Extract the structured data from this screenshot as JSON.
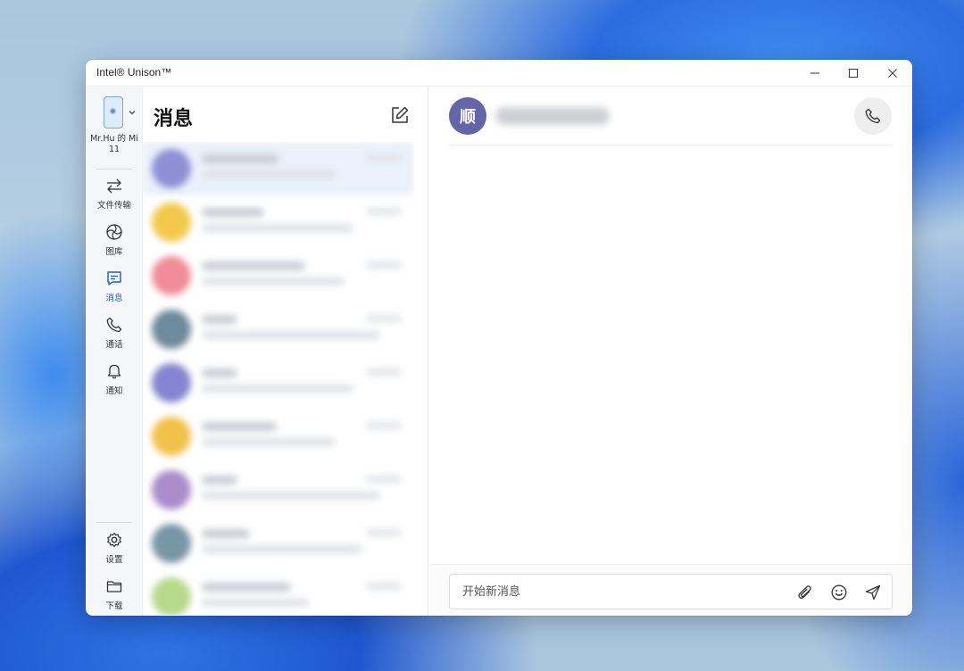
{
  "app": {
    "title": "Intel® Unison™"
  },
  "window_controls": {
    "minimize": "minimize-icon",
    "maximize": "maximize-icon",
    "close": "close-icon"
  },
  "device": {
    "name": "Mr.Hu 的 Mi 11",
    "icon": "phone-icon"
  },
  "nav": {
    "items": [
      {
        "id": "file-transfer",
        "label": "文件传输",
        "icon": "transfer-arrows-icon"
      },
      {
        "id": "gallery",
        "label": "图库",
        "icon": "gallery-aperture-icon"
      },
      {
        "id": "messages",
        "label": "消息",
        "icon": "message-icon",
        "active": true
      },
      {
        "id": "calls",
        "label": "通话",
        "icon": "phone-call-icon"
      },
      {
        "id": "notifications",
        "label": "通知",
        "icon": "bell-icon"
      }
    ],
    "bottom": [
      {
        "id": "settings",
        "label": "设置",
        "icon": "gear-icon"
      },
      {
        "id": "downloads",
        "label": "下载",
        "icon": "folder-icon"
      }
    ]
  },
  "messages_pane": {
    "title": "消息",
    "compose_icon": "compose-icon",
    "conversations": [
      {
        "avatar_color": "#8f8fd6",
        "selected": true
      },
      {
        "avatar_color": "#f2c94c"
      },
      {
        "avatar_color": "#f08c97"
      },
      {
        "avatar_color": "#6f8a9c"
      },
      {
        "avatar_color": "#8484d0"
      },
      {
        "avatar_color": "#f2c14c"
      },
      {
        "avatar_color": "#a98cc9"
      },
      {
        "avatar_color": "#7a95a6"
      },
      {
        "avatar_color": "#b7d98c"
      }
    ]
  },
  "chat": {
    "avatar_initial": "顺",
    "avatar_color": "#6464a8",
    "call_icon": "phone-call-icon",
    "compose": {
      "placeholder": "开始新消息",
      "attach_icon": "paperclip-icon",
      "emoji_icon": "emoji-icon",
      "send_icon": "send-icon"
    }
  },
  "colors": {
    "accent": "#1a5fb4",
    "selected_row": "#eaf1fb"
  }
}
